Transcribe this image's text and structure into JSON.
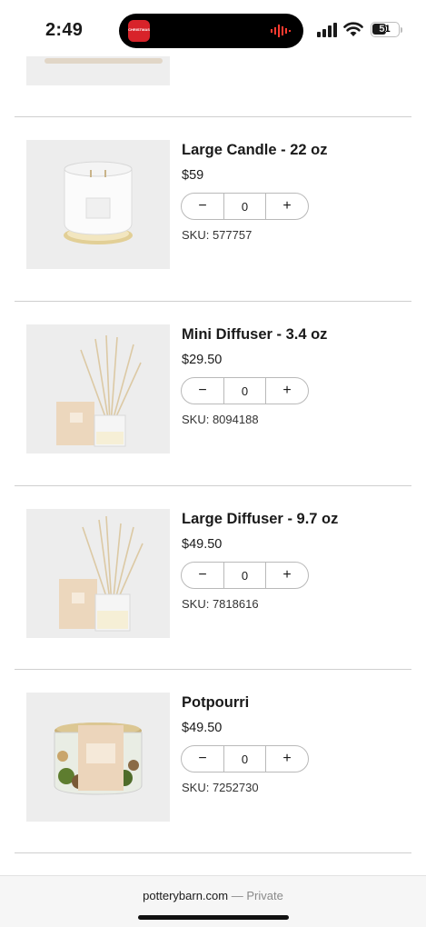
{
  "status_bar": {
    "time": "2:49",
    "battery": "51",
    "island_app_label": "CHRISTMAS"
  },
  "colors": {
    "accent": "#1a1a1a",
    "divider": "#cfcfcf",
    "island_app": "#d8232a"
  },
  "icons": [
    "christmas-app-icon",
    "voice-wave-icon",
    "cellular-signal-icon",
    "wifi-icon",
    "battery-icon",
    "minus-icon",
    "plus-icon"
  ],
  "products": [
    {
      "name": "Large Candle - 22 oz",
      "price": "$59",
      "quantity": "0",
      "sku": "SKU: 577757",
      "image": "candle"
    },
    {
      "name": "Mini Diffuser - 3.4 oz",
      "price": "$29.50",
      "quantity": "0",
      "sku": "SKU: 8094188",
      "image": "diffuser"
    },
    {
      "name": "Large Diffuser - 9.7 oz",
      "price": "$49.50",
      "quantity": "0",
      "sku": "SKU: 7818616",
      "image": "diffuser"
    },
    {
      "name": "Potpourri",
      "price": "$49.50",
      "quantity": "0",
      "sku": "SKU: 7252730",
      "image": "potpourri"
    }
  ],
  "stepper": {
    "minus": "−",
    "plus": "+"
  },
  "browser": {
    "domain": "potterybarn.com",
    "separator": " — ",
    "mode": "Private"
  }
}
